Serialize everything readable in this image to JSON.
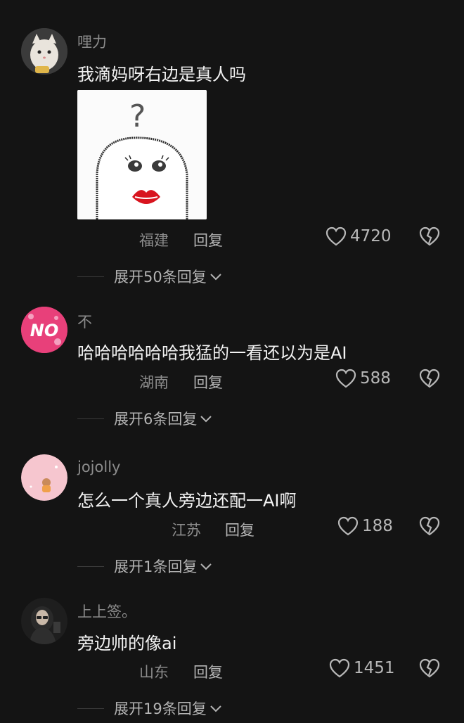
{
  "comments": [
    {
      "username": "哩力",
      "text": "我滴妈呀右边是真人吗",
      "location": "福建",
      "reply_label": "回复",
      "likes": "4720",
      "expand_label": "展开50条回复"
    },
    {
      "username": "不",
      "text": "哈哈哈哈哈哈我猛的一看还以为是AI",
      "location": "湖南",
      "reply_label": "回复",
      "likes": "588",
      "expand_label": "展开6条回复"
    },
    {
      "username": "jojolly",
      "text": "怎么一个真人旁边还配一AI啊",
      "location": "江苏",
      "reply_label": "回复",
      "likes": "188",
      "expand_label": "展开1条回复"
    },
    {
      "username": "上上签。",
      "text": "旁边帅的像ai",
      "location": "山东",
      "reply_label": "回复",
      "likes": "1451",
      "expand_label": "展开19条回复"
    }
  ],
  "sticker": {
    "question_mark": "?"
  },
  "icons": [
    "heart-icon",
    "broken-heart-icon",
    "chevron-down-icon"
  ],
  "colors": {
    "background": "#141414",
    "muted": "#8c8c8c",
    "text": "#f2f2f2",
    "avatar_no": "#e8407a"
  }
}
